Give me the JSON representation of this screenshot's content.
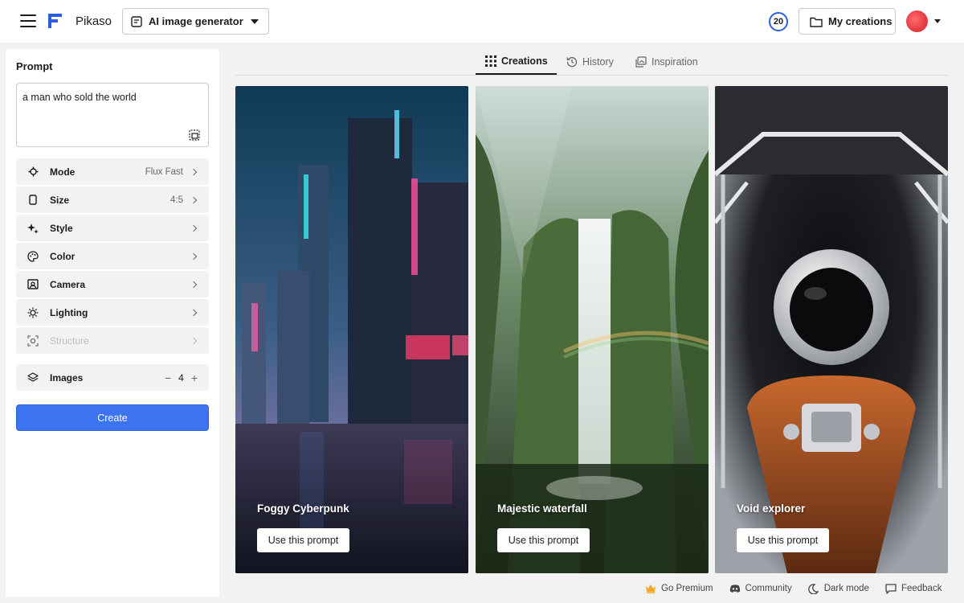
{
  "header": {
    "brand": "Pikaso",
    "tool_select": "AI image generator",
    "credits": "20",
    "my_creations": "My creations"
  },
  "sidebar": {
    "prompt_label": "Prompt",
    "prompt_value": "a man who sold the world",
    "options": [
      {
        "label": "Mode",
        "value": "Flux Fast",
        "icon": "sparkle-gear-icon"
      },
      {
        "label": "Size",
        "value": "4:5",
        "icon": "aspect-ratio-icon"
      },
      {
        "label": "Style",
        "value": "",
        "icon": "magic-stars-icon"
      },
      {
        "label": "Color",
        "value": "",
        "icon": "palette-icon"
      },
      {
        "label": "Camera",
        "value": "",
        "icon": "camera-frame-icon"
      },
      {
        "label": "Lighting",
        "value": "",
        "icon": "sun-icon"
      },
      {
        "label": "Structure",
        "value": "",
        "icon": "structure-icon",
        "disabled": true
      }
    ],
    "images": {
      "label": "Images",
      "value": "4",
      "minus": "−",
      "plus": "+"
    },
    "create_label": "Create"
  },
  "tabs": [
    {
      "label": "Creations",
      "active": true,
      "icon": "grid-icon"
    },
    {
      "label": "History",
      "active": false,
      "icon": "history-icon"
    },
    {
      "label": "Inspiration",
      "active": false,
      "icon": "images-icon"
    }
  ],
  "cards": [
    {
      "title": "Foggy Cyberpunk",
      "button": "Use this prompt"
    },
    {
      "title": "Majestic waterfall",
      "button": "Use this prompt"
    },
    {
      "title": "Void explorer",
      "button": "Use this prompt"
    }
  ],
  "footer": {
    "premium": "Go Premium",
    "community": "Community",
    "dark_mode": "Dark mode",
    "feedback": "Feedback"
  },
  "colors": {
    "accent": "#3b73f0",
    "background": "#f2f2f3",
    "credits_ring": "#2b5fe0"
  }
}
